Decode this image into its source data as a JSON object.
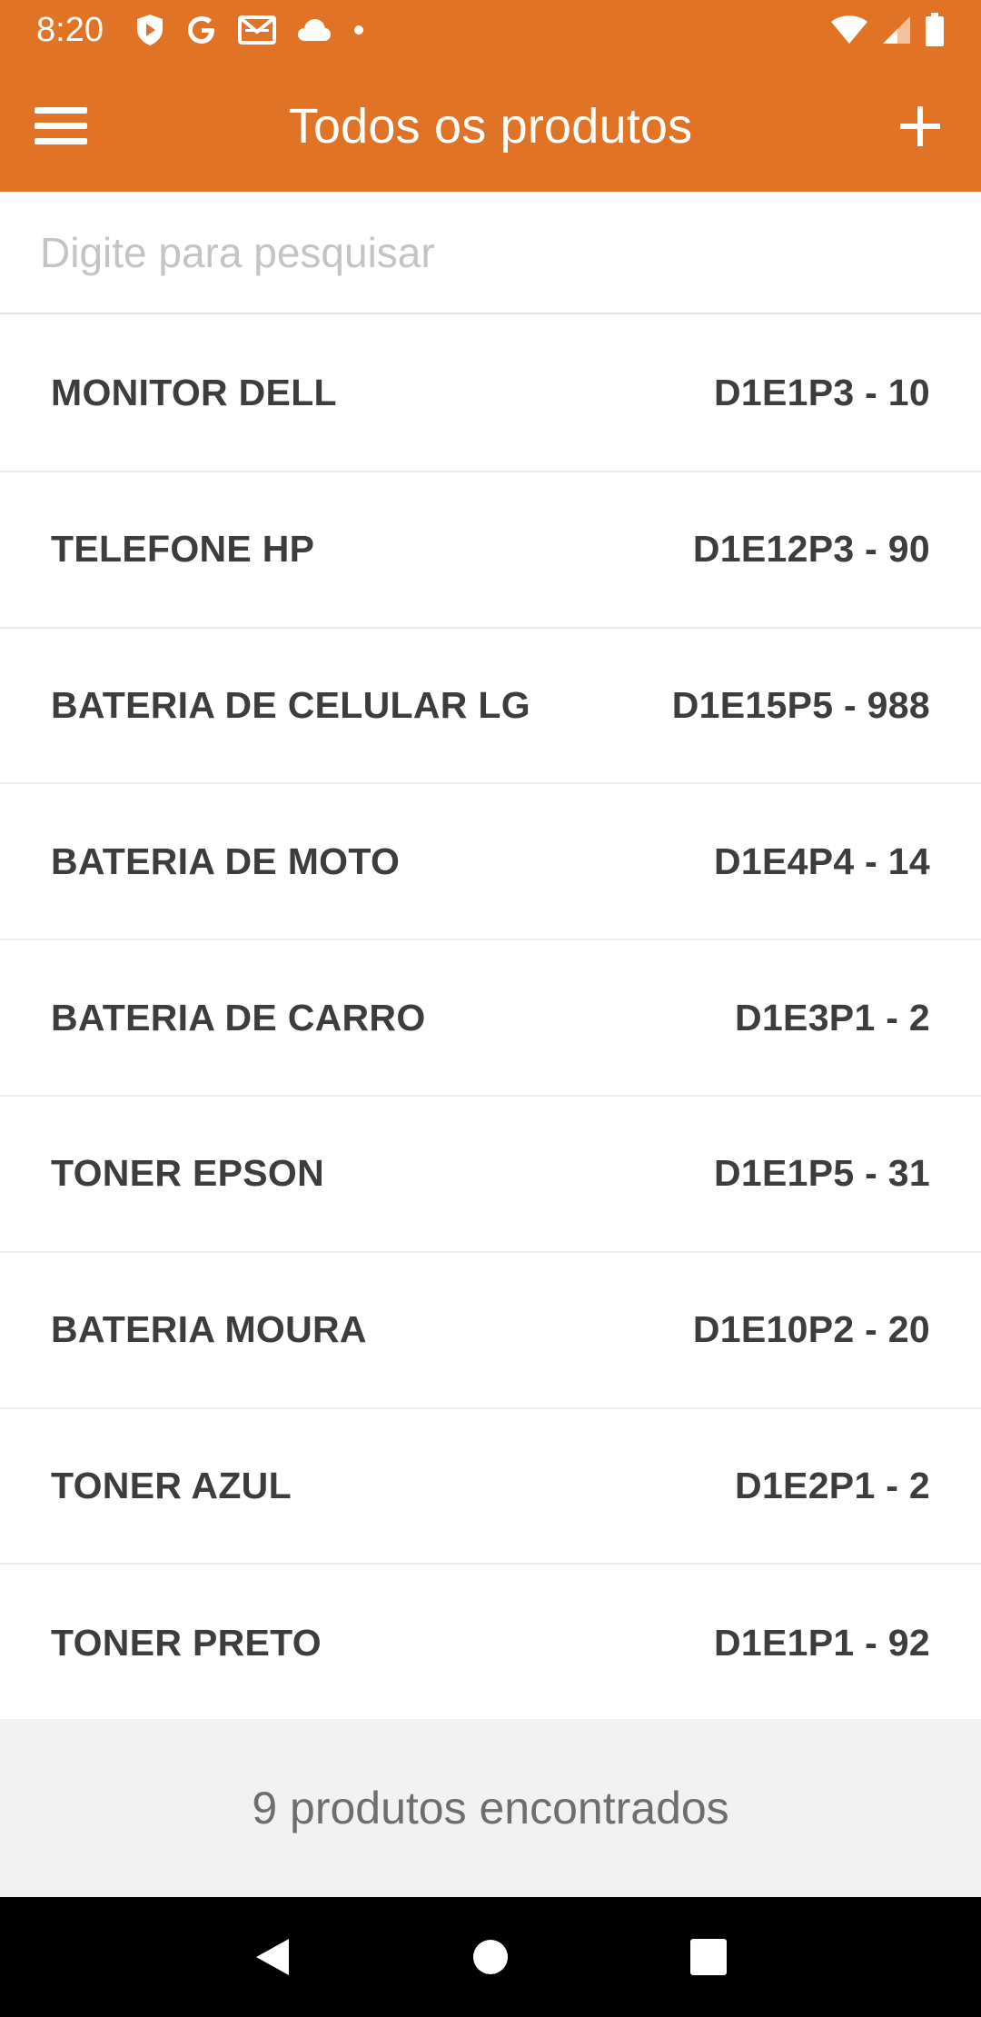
{
  "status_bar": {
    "time": "8:20",
    "icons_left": [
      "shield-icon",
      "google-icon",
      "gmail-icon",
      "cloud-icon",
      "dot-icon"
    ],
    "icons_right": [
      "wifi-icon",
      "signal-icon",
      "battery-icon"
    ]
  },
  "app_bar": {
    "title": "Todos os produtos",
    "background": "#e07325",
    "menu_icon": "hamburger-menu-icon",
    "add_icon": "plus-icon"
  },
  "search": {
    "placeholder": "Digite para pesquisar",
    "value": ""
  },
  "products": [
    {
      "name": "MONITOR DELL",
      "code": "D1E1P3 - 10"
    },
    {
      "name": "TELEFONE HP",
      "code": "D1E12P3 - 90"
    },
    {
      "name": "BATERIA DE CELULAR LG",
      "code": "D1E15P5 - 988"
    },
    {
      "name": "BATERIA DE MOTO",
      "code": "D1E4P4 - 14"
    },
    {
      "name": "BATERIA DE CARRO",
      "code": "D1E3P1 - 2"
    },
    {
      "name": "TONER EPSON",
      "code": "D1E1P5 - 31"
    },
    {
      "name": "BATERIA MOURA",
      "code": "D1E10P2 - 20"
    },
    {
      "name": "TONER AZUL",
      "code": "D1E2P1 - 2"
    },
    {
      "name": "TONER PRETO",
      "code": "D1E1P1 - 92"
    }
  ],
  "footer": {
    "count_text": "9 produtos encontrados"
  },
  "nav_bar": {
    "buttons": [
      "back-icon",
      "home-icon",
      "recents-icon"
    ]
  }
}
